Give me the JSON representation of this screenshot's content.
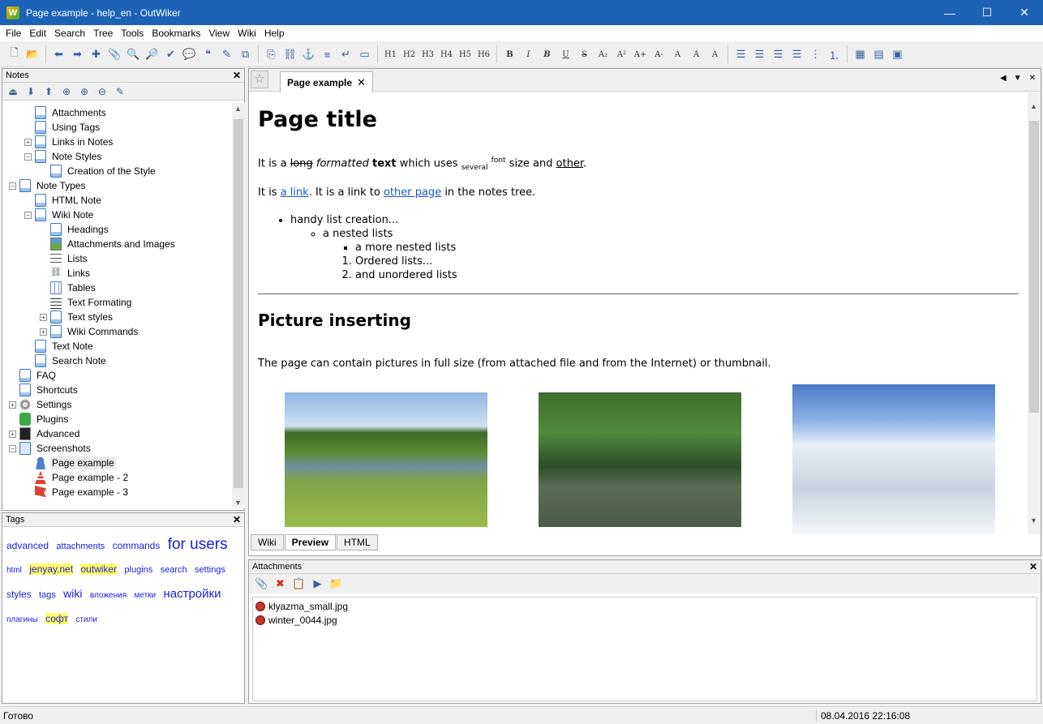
{
  "window": {
    "title": "Page example - help_en - OutWiker",
    "app_icon": "W",
    "controls": {
      "minimize": "—",
      "maximize": "☐",
      "close": "✕"
    }
  },
  "menu": [
    "File",
    "Edit",
    "Search",
    "Tree",
    "Tools",
    "Bookmarks",
    "View",
    "Wiki",
    "Help"
  ],
  "toolbar": {
    "groups": [
      [
        {
          "icon": "new-page-icon",
          "glyph": "🗋"
        },
        {
          "icon": "open-folder-icon",
          "glyph": "📂"
        }
      ],
      [
        {
          "icon": "back-icon",
          "glyph": "⬅"
        },
        {
          "icon": "forward-icon",
          "glyph": "➡"
        },
        {
          "icon": "add-icon",
          "glyph": "✚"
        },
        {
          "icon": "attach-icon",
          "glyph": "📎"
        },
        {
          "icon": "search-icon",
          "glyph": "🔍"
        },
        {
          "icon": "find-icon",
          "glyph": "🔎"
        },
        {
          "icon": "spellcheck-icon",
          "glyph": "✔"
        },
        {
          "icon": "comment-icon",
          "glyph": "💬"
        },
        {
          "icon": "quote-icon",
          "glyph": "❝"
        },
        {
          "icon": "pen-icon",
          "glyph": "✎"
        },
        {
          "icon": "code-icon",
          "glyph": "⧉"
        }
      ],
      [
        {
          "icon": "copy-icon",
          "glyph": "⎘"
        },
        {
          "icon": "link-icon",
          "glyph": "⛓"
        },
        {
          "icon": "anchor-icon",
          "glyph": "⚓"
        },
        {
          "icon": "lines-icon",
          "glyph": "≡"
        },
        {
          "icon": "return-icon",
          "glyph": "↵"
        },
        {
          "icon": "preformat-icon",
          "glyph": "▭"
        }
      ],
      [
        {
          "icon": "h1-icon",
          "glyph": "H1"
        },
        {
          "icon": "h2-icon",
          "glyph": "H2"
        },
        {
          "icon": "h3-icon",
          "glyph": "H3"
        },
        {
          "icon": "h4-icon",
          "glyph": "H4"
        },
        {
          "icon": "h5-icon",
          "glyph": "H5"
        },
        {
          "icon": "h6-icon",
          "glyph": "H6"
        }
      ],
      [
        {
          "icon": "bold-icon",
          "glyph": "B"
        },
        {
          "icon": "italic-icon",
          "glyph": "I"
        },
        {
          "icon": "bold-italic-icon",
          "glyph": "B"
        },
        {
          "icon": "underline-icon",
          "glyph": "U"
        },
        {
          "icon": "strike-icon",
          "glyph": "S"
        },
        {
          "icon": "subscript-icon",
          "glyph": "A₂"
        },
        {
          "icon": "superscript-icon",
          "glyph": "A²"
        },
        {
          "icon": "font-bigger-icon",
          "glyph": "A+"
        },
        {
          "icon": "font-smaller-icon",
          "glyph": "A-"
        },
        {
          "icon": "font-color-icon",
          "glyph": "A"
        },
        {
          "icon": "text-bg-icon",
          "glyph": "A"
        },
        {
          "icon": "mark-icon",
          "glyph": "A"
        }
      ],
      [
        {
          "icon": "align-left-icon",
          "glyph": "☰"
        },
        {
          "icon": "align-center-icon",
          "glyph": "☰"
        },
        {
          "icon": "align-right-icon",
          "glyph": "☰"
        },
        {
          "icon": "align-justify-icon",
          "glyph": "☰"
        },
        {
          "icon": "bullet-list-icon",
          "glyph": "⋮"
        },
        {
          "icon": "numbered-list-icon",
          "glyph": "⒈"
        }
      ],
      [
        {
          "icon": "table-icon",
          "glyph": "▦"
        },
        {
          "icon": "table-row-icon",
          "glyph": "▤"
        },
        {
          "icon": "table-cell-icon",
          "glyph": "▣"
        }
      ]
    ]
  },
  "notes_panel": {
    "title": "Notes",
    "close": "✕",
    "toolbar": [
      {
        "icon": "notebook-up-icon",
        "glyph": "⏏"
      },
      {
        "icon": "move-down-icon",
        "glyph": "⬇"
      },
      {
        "icon": "move-up-icon",
        "glyph": "⬆"
      },
      {
        "icon": "add-sibling-icon",
        "glyph": "⊕"
      },
      {
        "icon": "add-child-icon",
        "glyph": "⊕"
      },
      {
        "icon": "delete-page-icon",
        "glyph": "⊖"
      },
      {
        "icon": "edit-props-icon",
        "glyph": "✎"
      }
    ],
    "tree": [
      {
        "label": "Attachments",
        "level": 2,
        "icon": "page",
        "expander": ""
      },
      {
        "label": "Using Tags",
        "level": 2,
        "icon": "page",
        "expander": ""
      },
      {
        "label": "Links in Notes",
        "level": 2,
        "icon": "page",
        "expander": "+"
      },
      {
        "label": "Note Styles",
        "level": 2,
        "icon": "page",
        "expander": "−"
      },
      {
        "label": "Creation of the Style",
        "level": 3,
        "icon": "page",
        "expander": ""
      },
      {
        "label": "Note Types",
        "level": 1,
        "icon": "page",
        "expander": "−"
      },
      {
        "label": "HTML Note",
        "level": 2,
        "icon": "page",
        "expander": ""
      },
      {
        "label": "Wiki Note",
        "level": 2,
        "icon": "page",
        "expander": "−"
      },
      {
        "label": "Headings",
        "level": 3,
        "icon": "page",
        "expander": ""
      },
      {
        "label": "Attachments and Images",
        "level": 3,
        "icon": "img",
        "expander": ""
      },
      {
        "label": "Lists",
        "level": 3,
        "icon": "list",
        "expander": ""
      },
      {
        "label": "Links",
        "level": 3,
        "icon": "link",
        "expander": ""
      },
      {
        "label": "Tables",
        "level": 3,
        "icon": "table",
        "expander": ""
      },
      {
        "label": "Text Formating",
        "level": 3,
        "icon": "textf",
        "expander": ""
      },
      {
        "label": "Text styles",
        "level": 3,
        "icon": "page",
        "expander": "+"
      },
      {
        "label": "Wiki Commands",
        "level": 3,
        "icon": "page",
        "expander": "+"
      },
      {
        "label": "Text Note",
        "level": 2,
        "icon": "page",
        "expander": ""
      },
      {
        "label": "Search Note",
        "level": 2,
        "icon": "page",
        "expander": ""
      },
      {
        "label": "FAQ",
        "level": 1,
        "icon": "page",
        "expander": ""
      },
      {
        "label": "Shortcuts",
        "level": 1,
        "icon": "page",
        "expander": ""
      },
      {
        "label": "Settings",
        "level": 1,
        "icon": "gear",
        "expander": "+"
      },
      {
        "label": "Plugins",
        "level": 1,
        "icon": "plug",
        "expander": ""
      },
      {
        "label": "Advanced",
        "level": 1,
        "icon": "adv",
        "expander": "+"
      },
      {
        "label": "Screenshots",
        "level": 1,
        "icon": "shots",
        "expander": "−"
      },
      {
        "label": "Page example",
        "level": 2,
        "icon": "user",
        "expander": "",
        "selected": true
      },
      {
        "label": "Page example - 2",
        "level": 2,
        "icon": "cone",
        "expander": ""
      },
      {
        "label": "Page example - 3",
        "level": 2,
        "icon": "flag",
        "expander": ""
      }
    ]
  },
  "tags_panel": {
    "title": "Tags",
    "close": "✕",
    "tags": [
      {
        "text": "advanced",
        "size": 12,
        "hl": false
      },
      {
        "text": "attachments",
        "size": 11,
        "hl": false
      },
      {
        "text": "commands",
        "size": 12,
        "hl": false
      },
      {
        "text": "for users",
        "size": 19,
        "hl": false
      },
      {
        "text": "html",
        "size": 10,
        "hl": false
      },
      {
        "text": "jenyay.net",
        "size": 12,
        "hl": true
      },
      {
        "text": "outwiker",
        "size": 12,
        "hl": true
      },
      {
        "text": "plugins",
        "size": 11,
        "hl": false
      },
      {
        "text": "search",
        "size": 11,
        "hl": false
      },
      {
        "text": "settings",
        "size": 11,
        "hl": false
      },
      {
        "text": "styles",
        "size": 12,
        "hl": false
      },
      {
        "text": "tags",
        "size": 11,
        "hl": false
      },
      {
        "text": "wiki",
        "size": 14,
        "hl": false
      },
      {
        "text": "вложения",
        "size": 10,
        "hl": false
      },
      {
        "text": "метки",
        "size": 10,
        "hl": false
      },
      {
        "text": "настройки",
        "size": 15,
        "hl": false
      },
      {
        "text": "плагины",
        "size": 10,
        "hl": false
      },
      {
        "text": "софт",
        "size": 12,
        "hl": true
      },
      {
        "text": "стили",
        "size": 10,
        "hl": false
      }
    ]
  },
  "editor": {
    "tab_label": "Page example",
    "tab_close": "✕",
    "star": "☆",
    "tab_controls": {
      "prev": "◀",
      "menu": "▼",
      "close": "✕"
    },
    "preview": {
      "h1": "Page title",
      "p1": {
        "t1": "It is a ",
        "strike": "long",
        "italic": "formatted",
        "bold": "text",
        "t2": "which uses",
        "sub": "several",
        "sup": "font",
        "t3": "size and",
        "underline": "other",
        "t4": "."
      },
      "p2": {
        "t1": "It is ",
        "link1": "a link",
        "t2": ". It is a link to ",
        "link2": "other page",
        "t3": " in the notes tree."
      },
      "list": {
        "item1": "handy list creation...",
        "item2": "a nested lists",
        "item3": "a more nested lists",
        "ol1": "Ordered lists...",
        "ol2": "and unordered lists"
      },
      "h2": "Picture inserting",
      "p3": "The page can contain pictures in full size (from attached file and from the Internet) or thumbnail."
    },
    "mode_tabs": [
      "Wiki",
      "Preview",
      "HTML"
    ],
    "active_mode": "Preview"
  },
  "attachments": {
    "title": "Attachments",
    "close": "✕",
    "toolbar": [
      {
        "icon": "attach-file-icon",
        "glyph": "📎"
      },
      {
        "icon": "remove-icon",
        "glyph": "✖"
      },
      {
        "icon": "paste-icon",
        "glyph": "📋"
      },
      {
        "icon": "execute-icon",
        "glyph": "▶"
      },
      {
        "icon": "folder-icon",
        "glyph": "📁"
      }
    ],
    "files": [
      "klyazma_small.jpg",
      "winter_0044.jpg"
    ]
  },
  "status": {
    "left": "Готово",
    "right": "08.04.2016 22:16:08"
  }
}
